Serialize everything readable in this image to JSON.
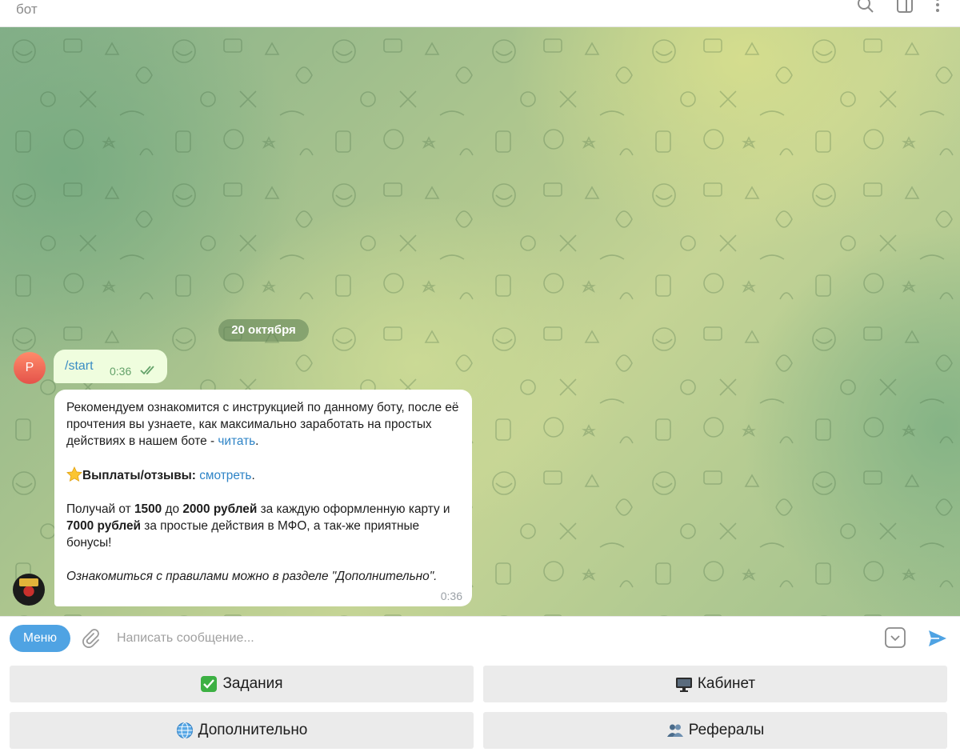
{
  "header": {
    "title": "бот"
  },
  "chat": {
    "date_label": "20 октября",
    "user_avatar_letter": "P",
    "outgoing": {
      "text": "/start",
      "time": "0:36"
    },
    "incoming": {
      "p1_text": "Рекомендуем ознакомится с инструкцией по данному боту, после её прочтения вы узнаете, как максимально заработать на простых действиях в нашем боте - ",
      "p1_link": "читать",
      "p1_end": ".",
      "p2_bold": "Выплаты/отзывы:",
      "p2_link": "смотреть",
      "p2_end": ".",
      "p3_a": "Получай от ",
      "p3_b1": "1500",
      "p3_c": " до ",
      "p3_b2": "2000 рублей",
      "p3_d": " за каждую оформленную карту и ",
      "p3_b3": "7000 рублей",
      "p3_e": " за простые действия в МФО, а так-же приятные бонусы!",
      "p4": "Ознакомиться с правилами можно в разделе \"Дополнительно\".",
      "time": "0:36"
    }
  },
  "composer": {
    "menu_label": "Меню",
    "placeholder": "Написать сообщение..."
  },
  "keyboard": {
    "buttons": [
      {
        "label": "Задания",
        "icon": "check-mark-button-icon"
      },
      {
        "label": "Кабинет",
        "icon": "desktop-computer-icon"
      },
      {
        "label": "Дополнительно",
        "icon": "globe-icon"
      },
      {
        "label": "Рефералы",
        "icon": "people-icon"
      }
    ]
  },
  "colors": {
    "accent": "#4fa3e3",
    "outgoing_bubble": "#effdde",
    "link": "#2d83c6",
    "read_ticks": "#64a26a"
  }
}
